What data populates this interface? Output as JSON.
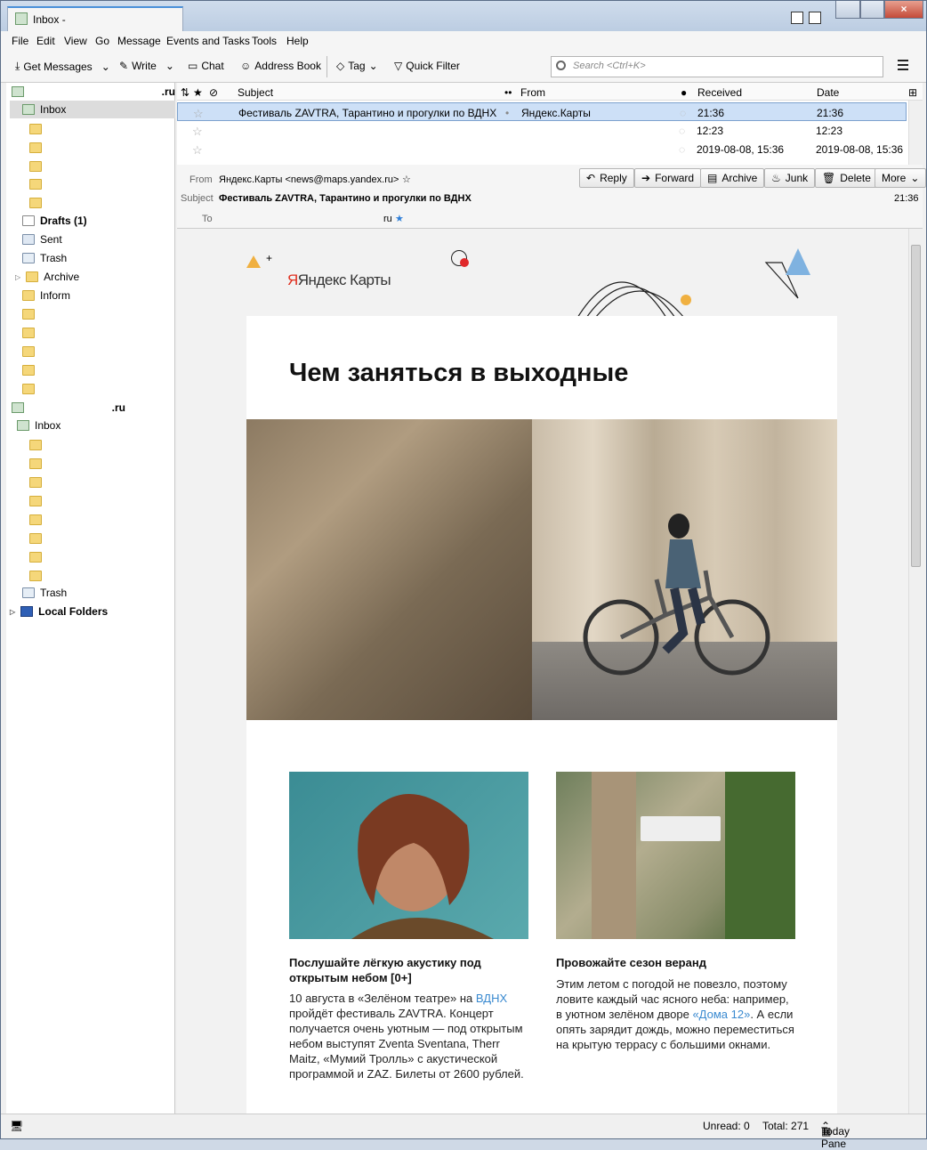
{
  "window": {
    "tab_title": "Inbox -",
    "close": "×"
  },
  "menu": [
    "File",
    "Edit",
    "View",
    "Go",
    "Message",
    "Events and Tasks",
    "Tools",
    "Help"
  ],
  "toolbar": {
    "get_messages": "Get Messages",
    "write": "Write",
    "chat": "Chat",
    "address_book": "Address Book",
    "tag": "Tag",
    "quick_filter": "Quick Filter",
    "search_placeholder": "Search <Ctrl+K>"
  },
  "folders": {
    "account1": ".ru",
    "inbox1": "Inbox",
    "drafts": "Drafts (1)",
    "sent": "Sent",
    "trash1": "Trash",
    "archive": "Archive",
    "inform": "Inform",
    "account2": ".ru",
    "inbox2": "Inbox",
    "trash2": "Trash",
    "local": "Local Folders"
  },
  "list": {
    "headers": {
      "subject": "Subject",
      "from": "From",
      "received": "Received",
      "date": "Date"
    },
    "rows": [
      {
        "subject": "Фестиваль ZAVTRA, Тарантино и прогулки по ВДНХ",
        "from": "Яндекс.Карты",
        "received": "21:36",
        "date": "21:36"
      },
      {
        "subject": "",
        "from": "",
        "received": "12:23",
        "date": "12:23"
      },
      {
        "subject": "",
        "from": "",
        "received": "2019-08-08, 15:36",
        "date": "2019-08-08, 15:36"
      }
    ]
  },
  "header": {
    "buttons": {
      "reply": "Reply",
      "forward": "Forward",
      "archive": "Archive",
      "junk": "Junk",
      "delete": "Delete",
      "more": "More"
    },
    "from_label": "From",
    "from": "Яндекс.Карты <news@maps.yandex.ru>",
    "subject_label": "Subject",
    "subject": "Фестиваль ZAVTRA, Тарантино и прогулки по ВДНХ",
    "time": "21:36",
    "to_label": "To",
    "to": "ru"
  },
  "email": {
    "brand": "Яндекс Карты",
    "title": "Чем заняться в выходные",
    "c1_title": "Послушайте лёгкую акустику под открытым небом [0+]",
    "c1_p1": "10 августа в «Зелёном театре» на ",
    "c1_link": "ВДНХ",
    "c1_p2": " пройдёт фестиваль ZAVTRA. Концерт получается очень уютным — под открытым небом выступят Zventa Sventana, Therr Maitz, «Мумий Тролль» с акустической программой и ZAZ. Билеты от 2600 рублей.",
    "c2_title": "Провожайте сезон веранд",
    "c2_p1": "Этим летом с погодой не повезло, поэтому ловите каждый час ясного неба: например, в уютном зелёном дворе ",
    "c2_link": "«Дома 12»",
    "c2_p2": ". А если опять зарядит дождь, можно переместиться на крытую террасу с большими окнами."
  },
  "status": {
    "unread": "Unread: 0",
    "total": "Total: 271",
    "today_pane": "Today Pane"
  }
}
